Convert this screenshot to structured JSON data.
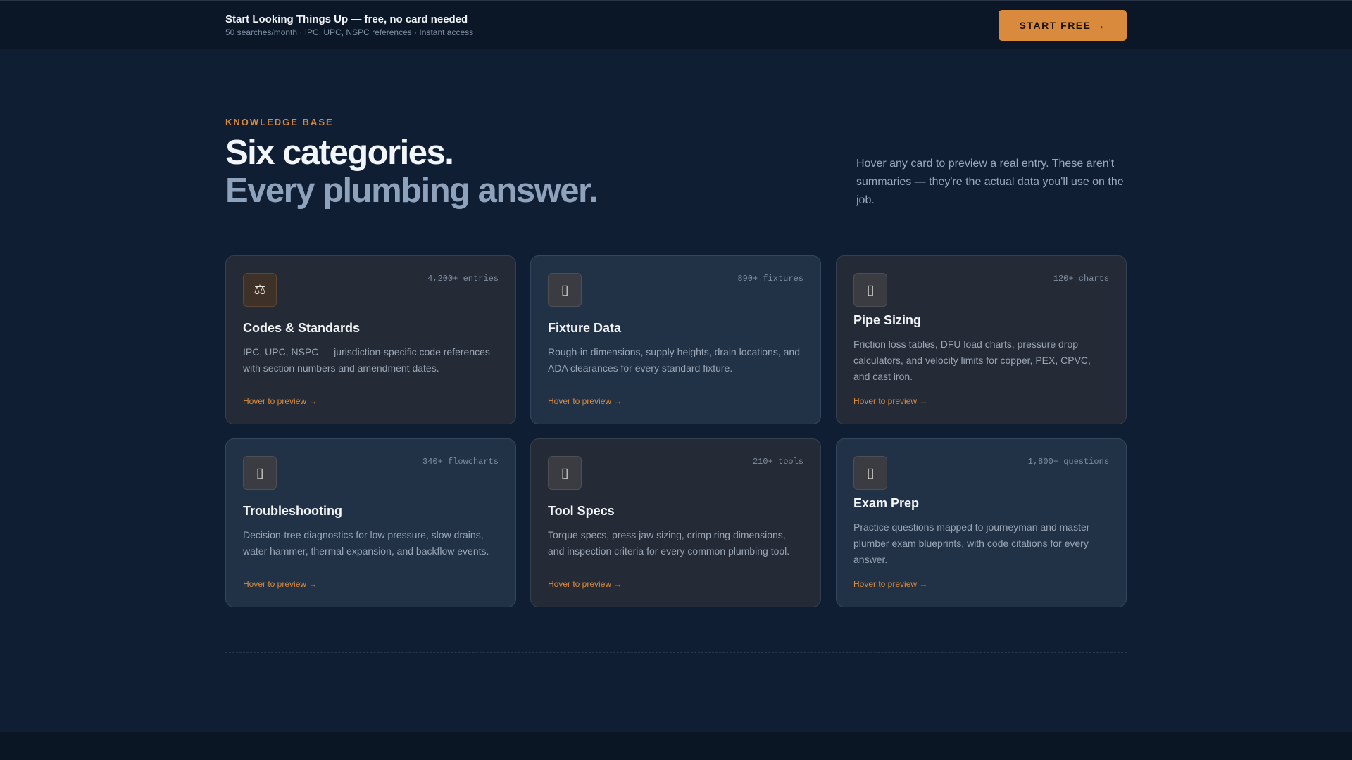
{
  "promo_bar": {
    "title": "Start Looking Things Up — free, no card needed",
    "subtitle": "50 searches/month · IPC, UPC, NSPC references · Instant access",
    "cta_label": "START FREE →"
  },
  "hero": {
    "eyebrow": "KNOWLEDGE BASE",
    "headline_line1": "Six categories.",
    "headline_line2": "Every plumbing answer.",
    "intro": "Hover any card to preview a real entry. These aren't summaries — they're the actual data you'll use on the job."
  },
  "categories": [
    {
      "icon": "scales-icon",
      "glyph": "⚖",
      "count": "4,200+ entries",
      "title": "Codes & Standards",
      "description": "IPC, UPC, NSPC — jurisdiction-specific code references with section numbers and amendment dates.",
      "preview_link": "Hover to preview →"
    },
    {
      "icon": "fixture-icon",
      "glyph": "▯",
      "count": "890+ fixtures",
      "title": "Fixture Data",
      "description": "Rough-in dimensions, supply heights, drain locations, and ADA clearances for every standard fixture.",
      "preview_link": "Hover to preview →"
    },
    {
      "icon": "pipe-icon",
      "glyph": "▯",
      "count": "120+ charts",
      "title": "Pipe Sizing",
      "description": "Friction loss tables, DFU load charts, pressure drop calculators, and velocity limits for copper, PEX, CPVC, and cast iron.",
      "preview_link": "Hover to preview →"
    },
    {
      "icon": "troubleshooting-icon",
      "glyph": "▯",
      "count": "340+ flowcharts",
      "title": "Troubleshooting",
      "description": "Decision-tree diagnostics for low pressure, slow drains, water hammer, thermal expansion, and backflow events.",
      "preview_link": "Hover to preview →"
    },
    {
      "icon": "tool-icon",
      "glyph": "▯",
      "count": "210+ tools",
      "title": "Tool Specs",
      "description": "Torque specs, press jaw sizing, crimp ring dimensions, and inspection criteria for every common plumbing tool.",
      "preview_link": "Hover to preview →"
    },
    {
      "icon": "exam-icon",
      "glyph": "▯",
      "count": "1,800+ questions",
      "title": "Exam Prep",
      "description": "Practice questions mapped to journeyman and master plumber exam blueprints, with code citations for every answer.",
      "preview_link": "Hover to preview →"
    }
  ],
  "colors": {
    "accent": "#d98a3d",
    "background": "#0f1e33",
    "card_warm": "#252b36",
    "card_cool": "#213247"
  }
}
